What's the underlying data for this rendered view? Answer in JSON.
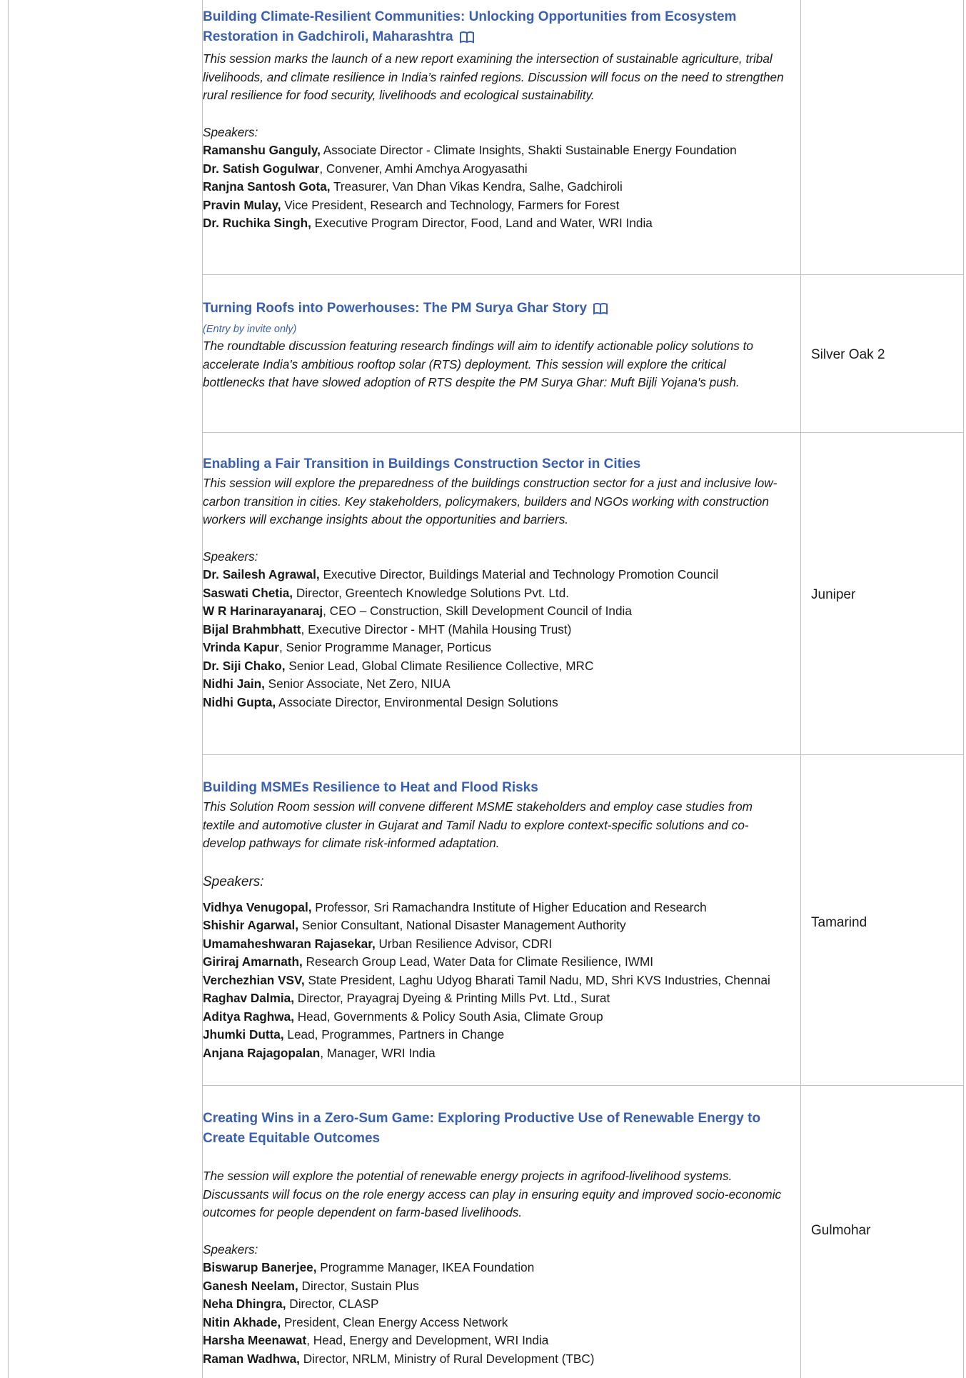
{
  "sessions": [
    {
      "title": "Building Climate-Resilient Communities: Unlocking Opportunities from Ecosystem Restoration in Gadchiroli, Maharashtra",
      "icon": "book-icon",
      "description": "This session marks the launch of a new report examining the intersection of sustainable agriculture, tribal livelihoods, and climate resilience in India’s rainfed regions. Discussion will focus on the need to strengthen rural resilience for food security, livelihoods and ecological sustainability.",
      "speakers_label": "Speakers:",
      "speakers": [
        {
          "name": "Ramanshu Ganguly,",
          "role": " Associate Director - Climate Insights, Shakti Sustainable Energy Foundation"
        },
        {
          "name": "Dr. Satish Gogulwar",
          "role": ", Convener, Amhi Amchya Arogyasathi"
        },
        {
          "name": "Ranjna Santosh Gota,",
          "role": " Treasurer, Van Dhan Vikas Kendra, Salhe, Gadchiroli"
        },
        {
          "name": "Pravin Mulay,",
          "role": " Vice President, Research and Technology, Farmers for Forest"
        },
        {
          "name": "Dr. Ruchika Singh,",
          "role": " Executive Program Director, Food, Land and Water, WRI India"
        }
      ],
      "venue": ""
    },
    {
      "title": "Turning Roofs into Powerhouses: The PM Surya Ghar Story",
      "icon": "book-icon",
      "note": "(Entry by invite only)",
      "description": "The roundtable discussion featuring research findings will aim to identify actionable policy solutions to accelerate India's ambitious rooftop solar (RTS) deployment. This session will explore the critical bottlenecks that have slowed adoption of RTS despite the PM Surya Ghar: Muft Bijli Yojana's push.",
      "venue": "Silver Oak 2"
    },
    {
      "title": "Enabling a Fair Transition in Buildings Construction Sector in Cities",
      "description": "This session will explore the preparedness of the buildings construction sector for a just and inclusive low-carbon transition in cities. Key stakeholders, policymakers, builders and NGOs working with construction workers will exchange insights about the opportunities and barriers.",
      "speakers_label": "Speakers:",
      "speakers": [
        {
          "name": "Dr. Sailesh Agrawal,",
          "role": " Executive Director, Buildings Material and Technology Promotion Council"
        },
        {
          "name": "Saswati Chetia,",
          "role": " Director, Greentech Knowledge Solutions Pvt. Ltd."
        },
        {
          "name": "W R Harinarayanaraj",
          "role": ", CEO – Construction, Skill Development Council of India"
        },
        {
          "name": "Bijal Brahmbhatt",
          "role": ", Executive Director - MHT (Mahila Housing Trust)"
        },
        {
          "name": "Vrinda Kapur",
          "role": ", Senior Programme Manager, Porticus"
        },
        {
          "name": "Dr. Siji Chako,",
          "role": " Senior Lead, Global Climate Resilience Collective, MRC"
        },
        {
          "name": "Nidhi Jain,",
          "role": " Senior Associate, Net Zero, NIUA"
        },
        {
          "name": "Nidhi Gupta,",
          "role": " Associate Director, Environmental Design Solutions"
        }
      ],
      "venue": "Juniper"
    },
    {
      "title": "Building MSMEs Resilience to Heat and Flood Risks",
      "description": "This Solution Room session will convene different MSME stakeholders and employ case studies from textile and automotive cluster in Gujarat and Tamil Nadu to explore context-specific solutions and co-develop pathways for climate risk-informed adaptation.",
      "speakers_label": "Speakers:",
      "speakers": [
        {
          "name": "Vidhya Venugopal,",
          "role": "  Professor, Sri Ramachandra Institute of Higher Education and Research"
        },
        {
          "name": "Shishir Agarwal,",
          "role": " Senior Consultant, National Disaster Management Authority"
        },
        {
          "name": "Umamaheshwaran Rajasekar,",
          "role": " Urban Resilience Advisor, CDRI"
        },
        {
          "name": "Giriraj Amarnath,",
          "role": " Research Group Lead, Water Data for Climate Resilience, IWMI"
        },
        {
          "name": "Verchezhian VSV,",
          "role": " State President, Laghu Udyog Bharati Tamil Nadu, MD, Shri KVS Industries, Chennai"
        },
        {
          "name": "Raghav Dalmia,",
          "role": " Director, Prayagraj Dyeing & Printing Mills Pvt. Ltd., Surat"
        },
        {
          "name": "Aditya Raghwa,",
          "role": " Head, Governments & Policy South Asia, Climate Group"
        },
        {
          "name": "Jhumki Dutta,",
          "role": " Lead, Programmes, Partners in Change"
        },
        {
          "name": "Anjana Rajagopalan",
          "role": ", Manager, WRI India"
        }
      ],
      "venue": "Tamarind"
    },
    {
      "title": "Creating Wins in a Zero-Sum Game: Exploring Productive Use of Renewable Energy to Create Equitable Outcomes",
      "description": "The session will explore the potential of renewable energy projects in agrifood-livelihood systems. Discussants will focus on the role energy access can play in ensuring equity and improved socio-economic outcomes for people dependent on farm-based livelihoods.",
      "speakers_label": "Speakers:",
      "speakers": [
        {
          "name": "Biswarup Banerjee,",
          "role": " Programme Manager, IKEA Foundation"
        },
        {
          "name": "Ganesh Neelam,",
          "role": " Director, Sustain Plus"
        },
        {
          "name": "Neha Dhingra,",
          "role": " Director, CLASP"
        },
        {
          "name": "Nitin Akhade,",
          "role": " President, Clean Energy Access Network"
        },
        {
          "name": "Harsha Meenawat",
          "role": ", Head, Energy and Development, WRI India"
        },
        {
          "name": "Raman Wadhwa,",
          "role": " Director, NRLM, Ministry of Rural Development (TBC)"
        }
      ],
      "venue": "Gulmohar"
    }
  ]
}
